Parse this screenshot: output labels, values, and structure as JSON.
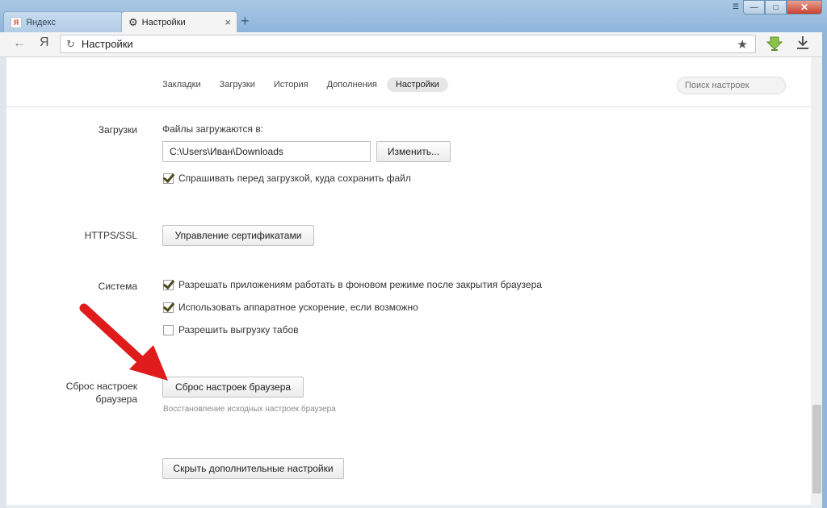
{
  "browser": {
    "tabs": [
      {
        "label": "Яндекс",
        "active": false
      },
      {
        "label": "Настройки",
        "active": true
      }
    ],
    "new_tab_label": "+",
    "logo_letter": "Я",
    "address": "Настройки",
    "window_controls": {
      "minimize": "—",
      "maximize": "□",
      "close": "✕"
    }
  },
  "settings_nav": {
    "items": [
      "Закладки",
      "Загрузки",
      "История",
      "Дополнения",
      "Настройки"
    ],
    "active_index": 4,
    "search_placeholder": "Поиск настроек"
  },
  "downloads": {
    "section_label": "Загрузки",
    "location_label": "Файлы загружаются в:",
    "path_value": "C:\\Users\\Иван\\Downloads",
    "change_button": "Изменить...",
    "ask_checkbox": {
      "label": "Спрашивать перед загрузкой, куда сохранить файл",
      "checked": true
    }
  },
  "https": {
    "section_label": "HTTPS/SSL",
    "manage_button": "Управление сертификатами"
  },
  "system": {
    "section_label": "Система",
    "options": [
      {
        "label": "Разрешать приложениям работать в фоновом режиме после закрытия браузера",
        "checked": true
      },
      {
        "label": "Использовать аппаратное ускорение, если возможно",
        "checked": true
      },
      {
        "label": "Разрешить выгрузку табов",
        "checked": false
      }
    ]
  },
  "reset": {
    "section_label_line1": "Сброс настроек",
    "section_label_line2": "браузера",
    "button": "Сброс настроек браузера",
    "hint": "Восстановление исходных настроек браузера"
  },
  "hide_advanced_button": "Скрыть дополнительные настройки",
  "colors": {
    "annotation_arrow": "#e01b1b",
    "download_badge": "#8bc34a"
  }
}
